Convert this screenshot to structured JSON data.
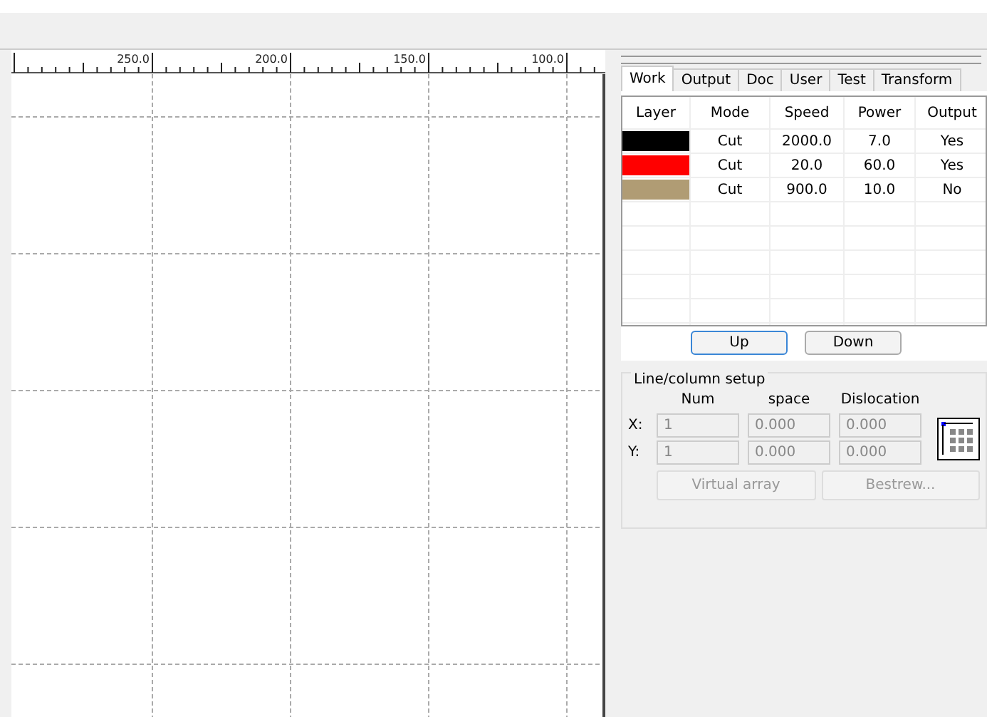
{
  "ruler": {
    "labels": [
      "250.0",
      "200.0",
      "150.0",
      "100.0"
    ]
  },
  "tabs": [
    {
      "label": "Work",
      "selected": true
    },
    {
      "label": "Output",
      "selected": false
    },
    {
      "label": "Doc",
      "selected": false
    },
    {
      "label": "User",
      "selected": false
    },
    {
      "label": "Test",
      "selected": false
    },
    {
      "label": "Transform",
      "selected": false
    }
  ],
  "table": {
    "columns": [
      "Layer",
      "Mode",
      "Speed",
      "Power",
      "Output"
    ],
    "rows": [
      {
        "color": "#000000",
        "mode": "Cut",
        "speed": "2000.0",
        "power": "7.0",
        "output": "Yes"
      },
      {
        "color": "#ff0000",
        "mode": "Cut",
        "speed": "20.0",
        "power": "60.0",
        "output": "Yes"
      },
      {
        "color": "#b09c74",
        "mode": "Cut",
        "speed": "900.0",
        "power": "10.0",
        "output": "No"
      }
    ]
  },
  "buttons": [
    "Up",
    "Down"
  ],
  "line_column_setup": {
    "title": "Line/column setup",
    "headers": [
      "Num",
      "space",
      "Dislocation"
    ],
    "rows": [
      {
        "label": "X:",
        "values": [
          "1",
          "0.000",
          "0.000"
        ]
      },
      {
        "label": "Y:",
        "values": [
          "1",
          "0.000",
          "0.000"
        ]
      }
    ],
    "disabled": true,
    "buttons": [
      "Virtual array",
      "Bestrew..."
    ]
  }
}
